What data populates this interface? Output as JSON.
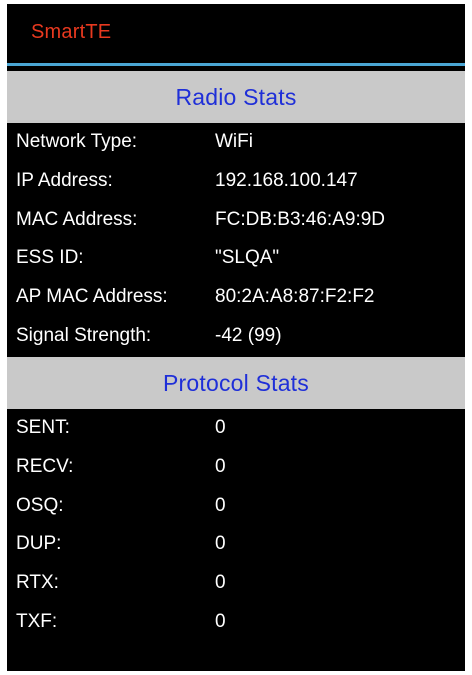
{
  "app": {
    "title": "SmartTE",
    "title_color": "#e8391f",
    "accent_color": "#4aa6d4"
  },
  "radio_stats": {
    "title": "Radio Stats",
    "rows": [
      {
        "label": "Network Type:",
        "value": "WiFi"
      },
      {
        "label": "IP Address:",
        "value": "192.168.100.147"
      },
      {
        "label": "MAC Address:",
        "value": "FC:DB:B3:46:A9:9D"
      },
      {
        "label": "ESS ID:",
        "value": "\"SLQA\""
      },
      {
        "label": "AP MAC Address:",
        "value": "80:2A:A8:87:F2:F2"
      },
      {
        "label": "Signal Strength:",
        "value": "-42 (99)"
      }
    ]
  },
  "protocol_stats": {
    "title": "Protocol Stats",
    "rows": [
      {
        "label": "SENT:",
        "value": "0"
      },
      {
        "label": "RECV:",
        "value": "0"
      },
      {
        "label": "OSQ:",
        "value": "0"
      },
      {
        "label": "DUP:",
        "value": "0"
      },
      {
        "label": "RTX:",
        "value": "0"
      },
      {
        "label": "TXF:",
        "value": "0"
      }
    ]
  }
}
